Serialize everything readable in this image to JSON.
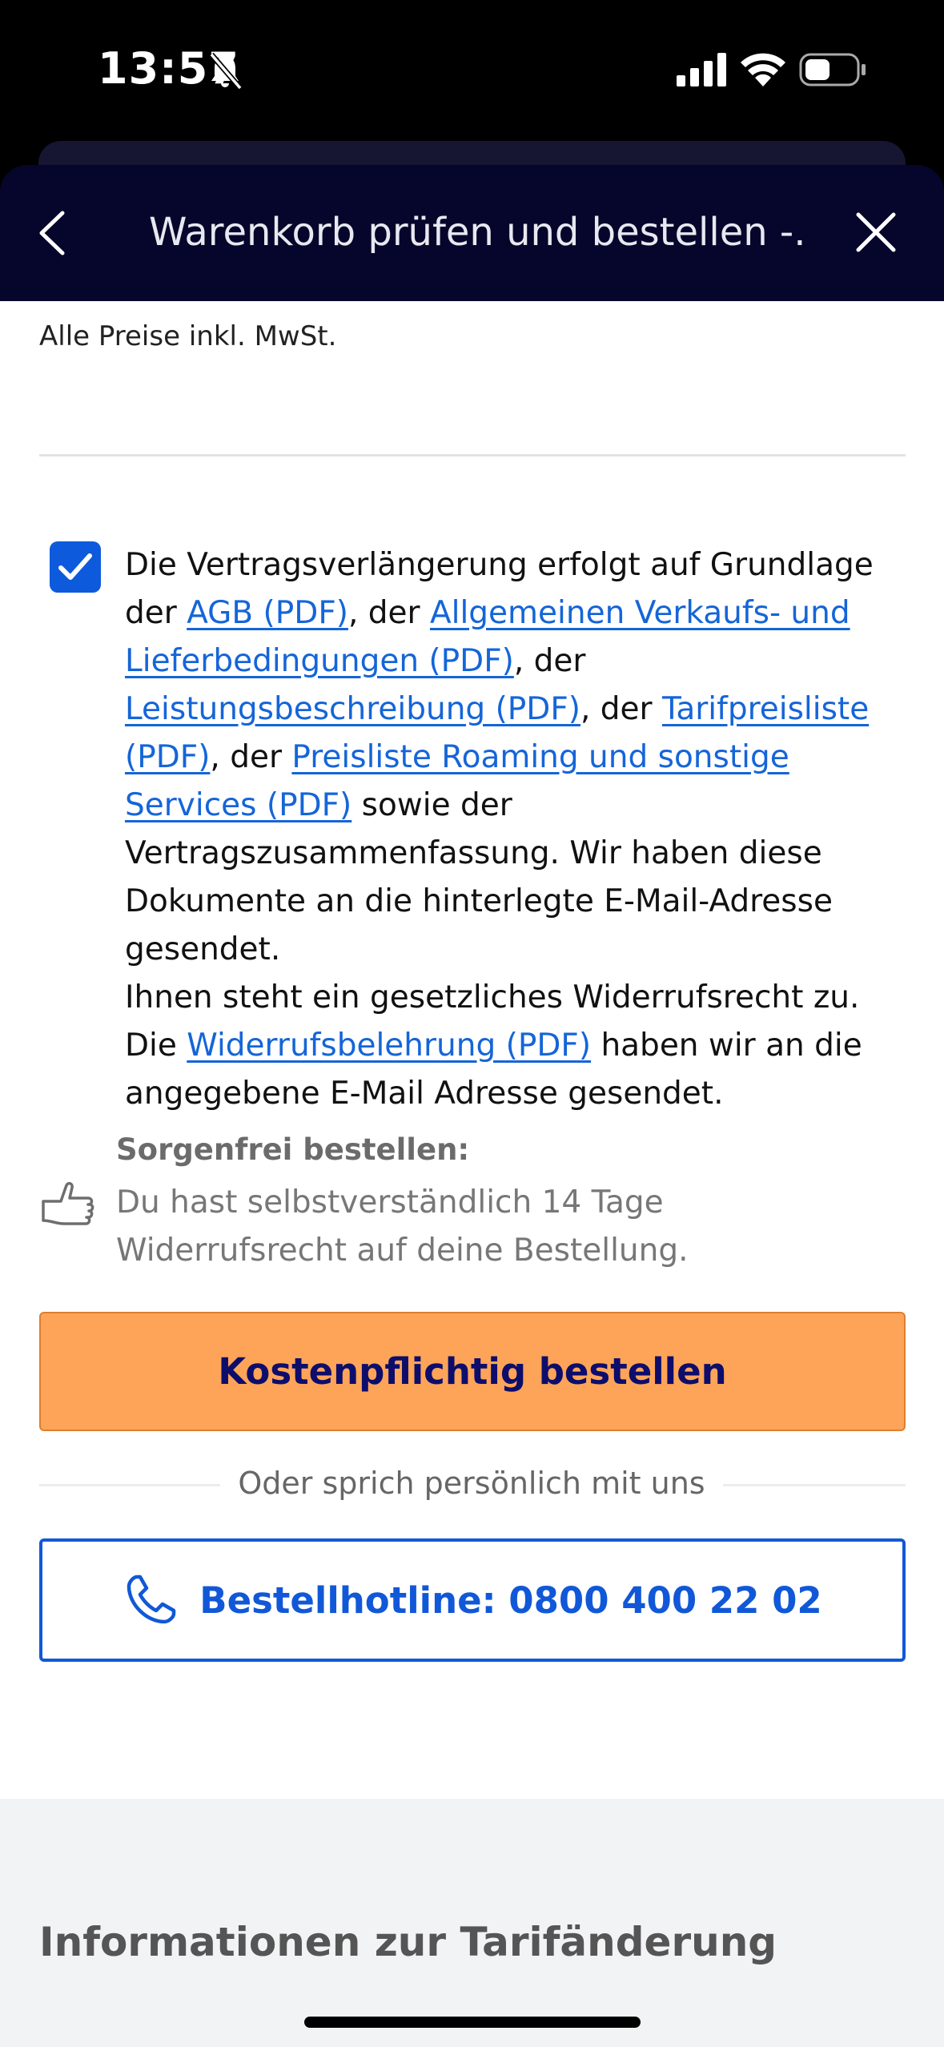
{
  "status_bar": {
    "time": "13:57",
    "icons": [
      "bell-slash-icon",
      "signal-icon",
      "wifi-icon",
      "battery-icon"
    ]
  },
  "header": {
    "title": "Warenkorb prüfen und bestellen -...",
    "back_icon": "chevron-left-icon",
    "close_icon": "close-icon"
  },
  "prices_note": "Alle Preise inkl. MwSt.",
  "consent": {
    "checked": true,
    "t1": "Die Vertragsverlängerung erfolgt auf Grundlage der ",
    "link_agb": "AGB (PDF)",
    "t2": ", der ",
    "link_avb": "Allgemeinen Verkaufs- und Lieferbedingungen (PDF)",
    "t3": ", der ",
    "link_leistung": "Leistungsbeschreibung (PDF)",
    "t4": ", der ",
    "link_tarif": "Tarifpreisliste (PDF)",
    "t5": ", der ",
    "link_roaming": "Preisliste Roaming und sonstige Services (PDF)",
    "t6": " sowie der Vertragszusammenfassung. Wir haben diese Dokumente an die hinterlegte E-Mail-Adresse gesendet.",
    "t7": "Ihnen steht ein gesetzliches Widerrufsrecht zu. Die ",
    "link_widerruf": "Widerrufsbelehrung (PDF)",
    "t8": " haben wir an die angegebene E-Mail Adresse gesendet."
  },
  "carefree": {
    "title": "Sorgenfrei bestellen:",
    "text": "Du hast selbstverständlich 14 Tage Widerrufsrecht auf deine Bestellung.",
    "icon": "thumbs-up-icon"
  },
  "order_button": "Kostenpflichtig bestellen",
  "or_text": "Oder sprich persönlich mit uns",
  "hotline_button": "Bestellhotline: 0800 400 22 02",
  "info_section_title": "Informationen zur Tarifänderung",
  "colors": {
    "header_bg": "#06062c",
    "order_button": "#fea458",
    "link": "#1565d8",
    "hotline_border": "#1158d8"
  }
}
